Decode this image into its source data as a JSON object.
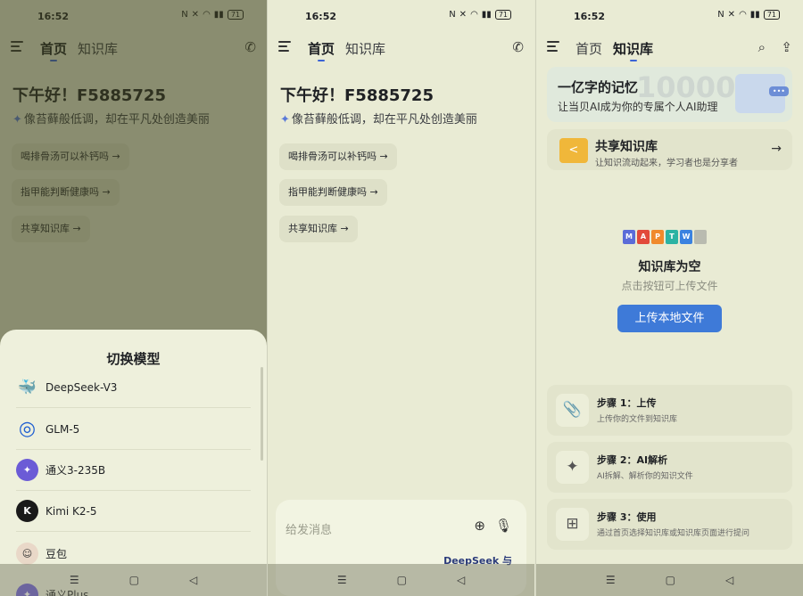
{
  "status": {
    "time": "16:52",
    "battery": "71"
  },
  "tabs": {
    "home": "首页",
    "knowledge": "知识库"
  },
  "home": {
    "greeting": "下午好！F5885725",
    "subtitle": "像苔藓般低调，却在平凡处创造美丽",
    "chips": [
      {
        "label": "喝排骨汤可以补钙吗 →"
      },
      {
        "label": "指甲能判断健康吗 →"
      },
      {
        "label": "共享知识库 →"
      }
    ]
  },
  "model_sheet": {
    "title": "切换模型",
    "models": [
      {
        "name": "DeepSeek-V3",
        "color": "#4d6bfe",
        "glyph": "🐳"
      },
      {
        "name": "GLM-5",
        "color": "#1f5fd1",
        "glyph": "◎"
      },
      {
        "name": "通义3-235B",
        "color": "#6b5bd6",
        "glyph": "✦"
      },
      {
        "name": "Kimi K2-5",
        "color": "#1a1a1a",
        "glyph": "K"
      },
      {
        "name": "豆包",
        "color": "#e9d8c8",
        "glyph": "☺"
      },
      {
        "name": "通义Plus",
        "color": "#6b5bd6",
        "glyph": "✦"
      }
    ]
  },
  "composer": {
    "placeholder": "给发消息",
    "model_label": "DeepSeek 与"
  },
  "knowledge": {
    "banner_title": "一亿字的记忆",
    "banner_subtitle": "让当贝AI成为你的专属个人AI助理",
    "banner_bg_number": "100000",
    "share_title": "共享知识库",
    "share_subtitle": "让知识流动起来，学习者也是分享者",
    "file_types": [
      {
        "label": "M",
        "color": "#5b6cd8"
      },
      {
        "label": "A",
        "color": "#e24a3b"
      },
      {
        "label": "P",
        "color": "#f08a2c"
      },
      {
        "label": "T",
        "color": "#2bb3a3"
      },
      {
        "label": "W",
        "color": "#3b82e0"
      },
      {
        "label": "",
        "color": "#b9bbb0"
      }
    ],
    "empty_title": "知识库为空",
    "empty_subtitle": "点击按钮可上传文件",
    "upload_label": "上传本地文件",
    "steps": [
      {
        "title": "步骤 1：上传",
        "desc": "上传你的文件到知识库",
        "icon": "📎"
      },
      {
        "title": "步骤 2：AI解析",
        "desc": "AI拆解、解析你的知识文件",
        "icon": "✦"
      },
      {
        "title": "步骤 3：使用",
        "desc": "通过首页选择知识库或知识库页面进行提问",
        "icon": "⊞"
      }
    ]
  },
  "nav": {
    "menu": "☰",
    "home": "▢",
    "back": "◁"
  }
}
